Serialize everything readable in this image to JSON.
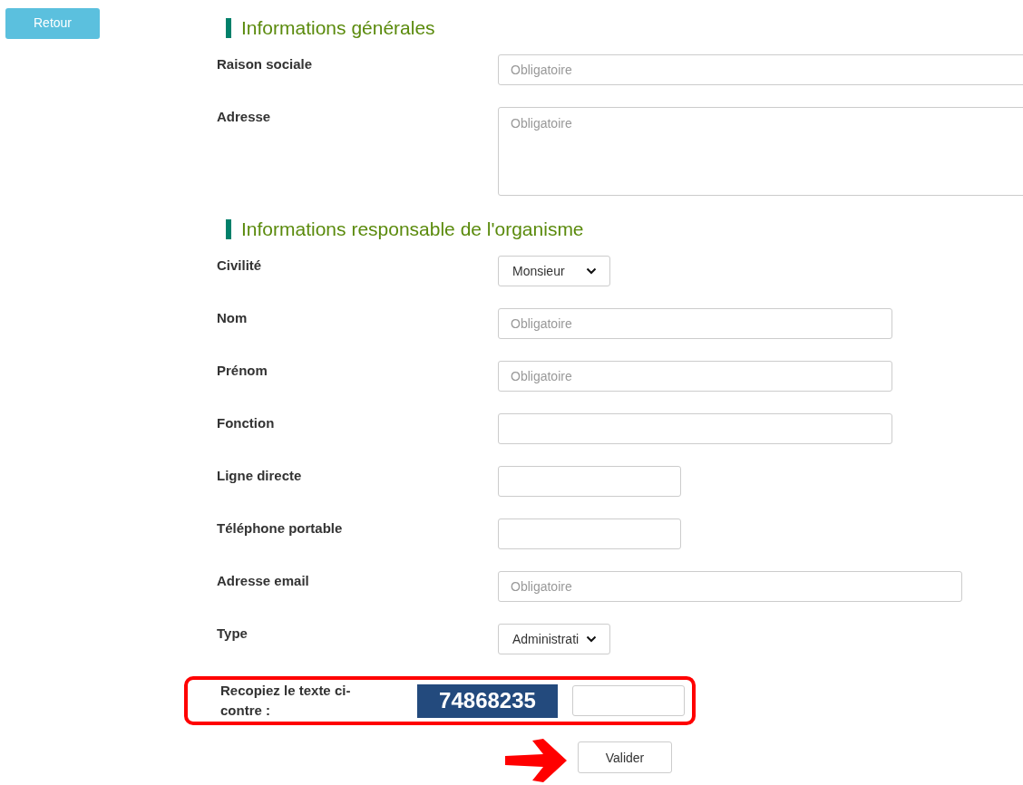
{
  "back_button": "Retour",
  "sections": [
    {
      "title": "Informations générales",
      "fields": [
        {
          "label": "Raison sociale",
          "kind": "text",
          "placeholder": "Obligatoire"
        },
        {
          "label": "Adresse",
          "kind": "textarea",
          "placeholder": "Obligatoire"
        }
      ]
    },
    {
      "title": "Informations responsable de l'organisme",
      "fields": [
        {
          "label": "Civilité",
          "kind": "select",
          "value": "Monsieur"
        },
        {
          "label": "Nom",
          "kind": "text",
          "placeholder": "Obligatoire"
        },
        {
          "label": "Prénom",
          "kind": "text",
          "placeholder": "Obligatoire"
        },
        {
          "label": "Fonction",
          "kind": "text"
        },
        {
          "label": "Ligne directe",
          "kind": "text"
        },
        {
          "label": "Téléphone portable",
          "kind": "text"
        },
        {
          "label": "Adresse email",
          "kind": "text",
          "placeholder": "Obligatoire"
        },
        {
          "label": "Type",
          "kind": "select",
          "value": "Administrati"
        }
      ]
    }
  ],
  "captcha": {
    "label": "Recopiez le texte ci-contre :",
    "code": "74868235",
    "highlighted": true
  },
  "submit_button": "Valider"
}
